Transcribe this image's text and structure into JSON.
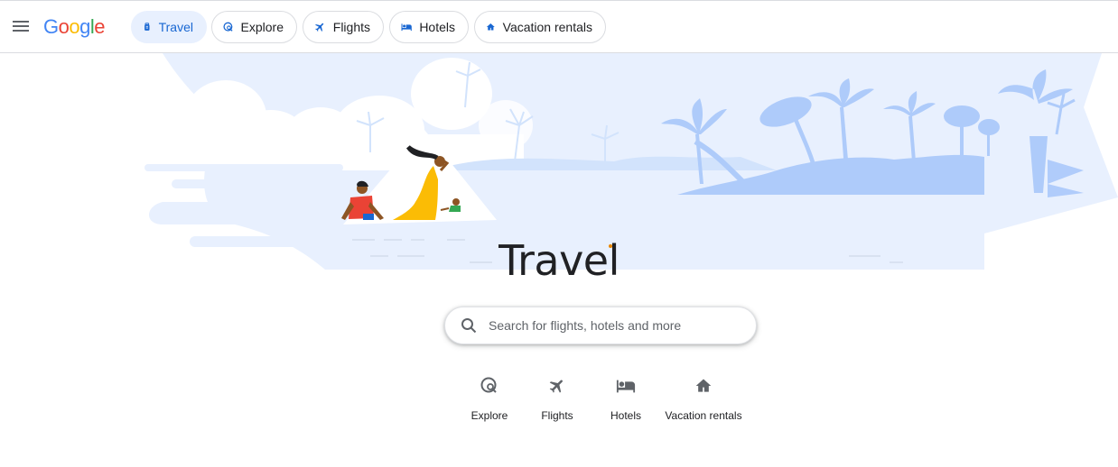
{
  "header": {
    "logo": [
      "G",
      "o",
      "o",
      "g",
      "l",
      "e"
    ],
    "logo_colors": [
      "#4285f4",
      "#ea4335",
      "#fbbc05",
      "#4285f4",
      "#34a853",
      "#ea4335"
    ],
    "chips": [
      {
        "label": "Travel",
        "icon": "luggage-icon",
        "active": true
      },
      {
        "label": "Explore",
        "icon": "explore-icon",
        "active": false
      },
      {
        "label": "Flights",
        "icon": "flight-icon",
        "active": false
      },
      {
        "label": "Hotels",
        "icon": "hotel-icon",
        "active": false
      },
      {
        "label": "Vacation rentals",
        "icon": "house-icon",
        "active": false
      }
    ]
  },
  "main": {
    "title": "Travel",
    "search_placeholder": "Search for flights, hotels and more",
    "quick_links": [
      {
        "label": "Explore",
        "icon": "explore-icon"
      },
      {
        "label": "Flights",
        "icon": "flight-icon"
      },
      {
        "label": "Hotels",
        "icon": "hotel-icon"
      },
      {
        "label": "Vacation rentals",
        "icon": "house-icon"
      }
    ]
  },
  "colors": {
    "accent": "#1967d2",
    "chip_active_bg": "#e8f0fe",
    "illustration_light": "#e8f0fe",
    "illustration_mid": "#aecbfa",
    "illustration_dark": "#8ab4f8",
    "title_dot": "#ea8600"
  }
}
